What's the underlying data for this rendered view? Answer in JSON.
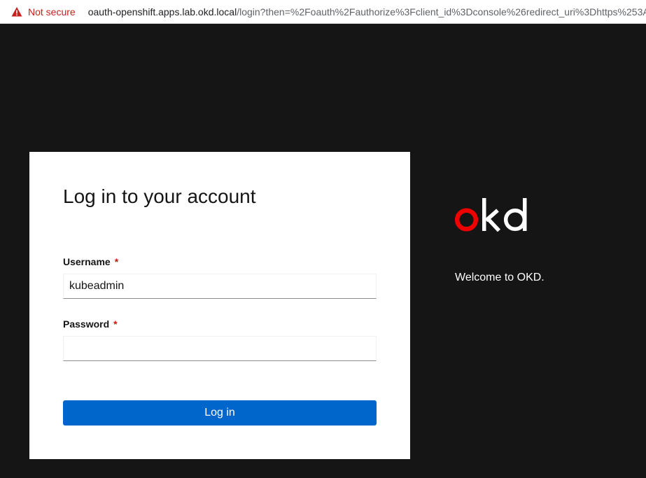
{
  "browser": {
    "security_label": "Not secure",
    "url_host": "oauth-openshift.apps.lab.okd.local",
    "url_path": "/login?then=%2Foauth%2Fauthorize%3Fclient_id%3Dconsole%26redirect_uri%3Dhttps%253A%2",
    "warning_icon": "warning-triangle-icon",
    "warning_color": "#c5221f"
  },
  "login": {
    "title": "Log in to your account",
    "username_label": "Username",
    "username_value": "kubeadmin",
    "password_label": "Password",
    "password_value": "",
    "required_marker": "*",
    "submit_label": "Log in"
  },
  "brand": {
    "logo_text": "okd",
    "welcome": "Welcome to OKD."
  },
  "colors": {
    "background": "#151515",
    "primary": "#0066cc",
    "logo_accent": "#ee0000",
    "required": "#c9190b"
  }
}
